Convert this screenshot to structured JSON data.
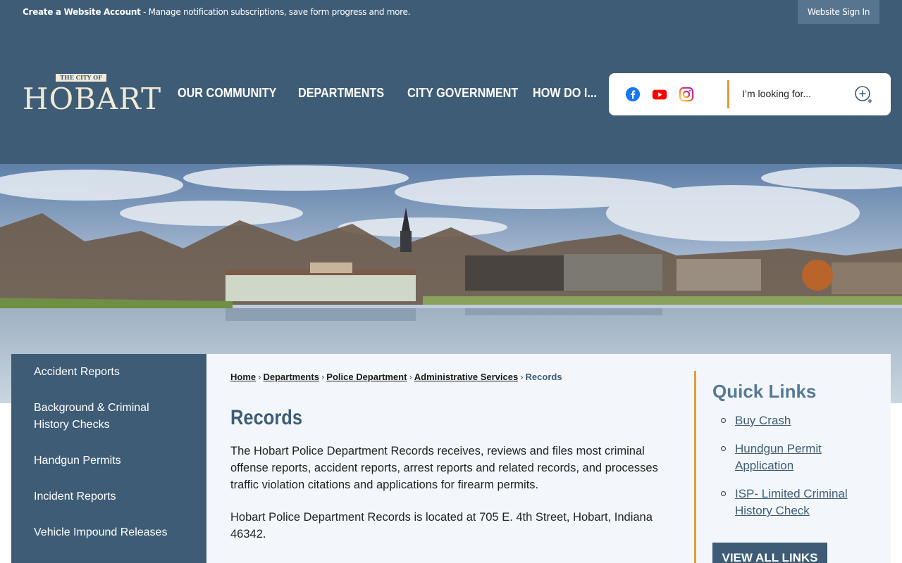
{
  "topbar": {
    "account_bold": "Create a Website Account",
    "account_text": " - Manage notification subscriptions, save form progress and more.",
    "signin": "Website Sign In"
  },
  "logo": {
    "small": "THE CITY OF",
    "big": "HOBART"
  },
  "nav": [
    {
      "label": "OUR COMMUNITY"
    },
    {
      "label": "DEPARTMENTS"
    },
    {
      "label": "CITY GOVERNMENT"
    },
    {
      "label": "HOW DO I..."
    }
  ],
  "search": {
    "placeholder": "I’m looking for..."
  },
  "social": [
    "facebook-icon",
    "youtube-icon",
    "instagram-icon"
  ],
  "sidenav": [
    {
      "label": "Accident Reports"
    },
    {
      "label": "Background & Criminal History Checks"
    },
    {
      "label": "Handgun Permits"
    },
    {
      "label": "Incident Reports"
    },
    {
      "label": "Vehicle Impound Releases"
    }
  ],
  "breadcrumb": {
    "home": "Home",
    "departments": "Departments",
    "police": "Police Department",
    "admin": "Administrative Services",
    "current": "Records"
  },
  "page": {
    "title": "Records",
    "para1": "The Hobart Police Department Records receives, reviews and files most criminal offense reports, accident reports, arrest reports and related records, and processes traffic violation citations and applications for firearm permits.",
    "para2": "Hobart Police Department Records is located at 705 E. 4th Street, Hobart, Indiana 46342."
  },
  "quick_links": {
    "title": "Quick Links",
    "items": [
      {
        "label": "Buy Crash"
      },
      {
        "label": "Hundgun Permit Application"
      },
      {
        "label": "ISP- Limited Criminal History Check"
      }
    ],
    "view_all": "VIEW ALL LINKS"
  },
  "colors": {
    "brand_blue": "#3e5c75",
    "accent_orange": "#e19a3b",
    "cream": "#f1ead8"
  }
}
